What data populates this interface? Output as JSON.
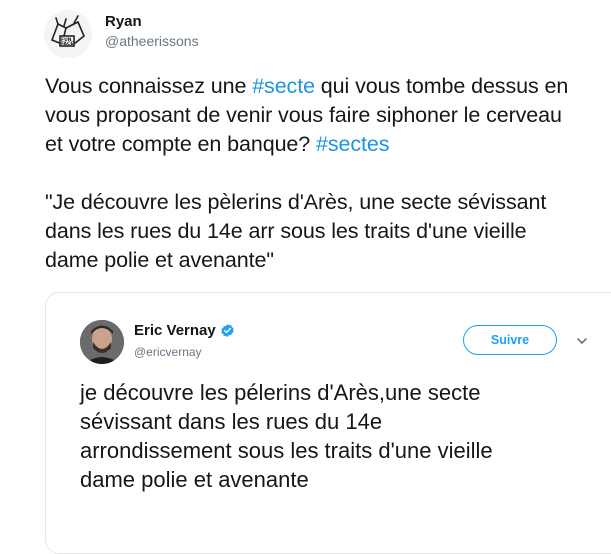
{
  "tweet": {
    "author": {
      "name": "Ryan",
      "handle": "@atheerissons"
    },
    "text": {
      "line1_pre": "Vous connaissez une ",
      "line1_tag": "#secte",
      "line1_post": " qui vous tombe dessus en",
      "line2": "vous proposant de venir vous faire siphoner le cerveau",
      "line3_pre": "et votre compte en banque? ",
      "line3_tag": "#sectes",
      "line4": "\"Je découvre les pèlerins d'Arès, une secte sévissant",
      "line5": "dans les rues du 14e arr sous les traits d'une vieille",
      "line6": "dame polie et avenante\""
    }
  },
  "quoted": {
    "author": {
      "name": "Eric Vernay",
      "handle": "@ericvernay",
      "verified_icon": "verified-badge-icon"
    },
    "follow_label": "Suivre",
    "menu_icon": "chevron-down-icon",
    "text": {
      "line1": "je découvre les pélerins d'Arès,une secte",
      "line2": "sévissant dans les rues du 14e",
      "line3": "arrondissement sous les traits d'une vieille",
      "line4": "dame polie et avenante"
    }
  },
  "colors": {
    "accent": "#1da1f2",
    "hashtag": "#1b95e0",
    "text": "#14171a",
    "muted": "#657786",
    "border": "#e1e8ed"
  }
}
